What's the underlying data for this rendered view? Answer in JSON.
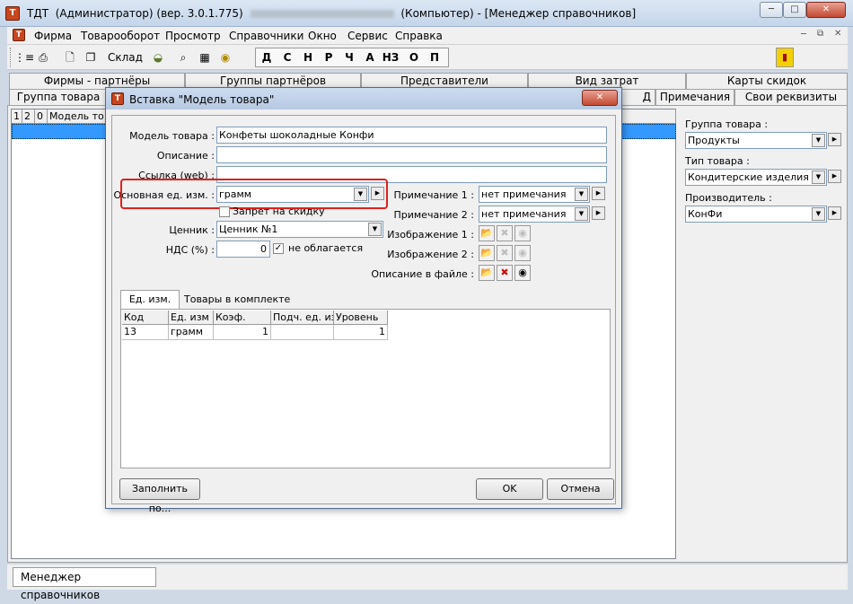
{
  "window": {
    "title_app": "ТДТ",
    "title_user": "(Администратор)",
    "title_version": "(вер. 3.0.1.775)",
    "title_computer": "(Компьютер)",
    "title_module": "- [Менеджер справочников]",
    "min": "─",
    "max": "□",
    "close": "✕",
    "app_icon": "Т"
  },
  "menu": [
    "Фирма",
    "Товарооборот",
    "Просмотр",
    "Справочники",
    "Окно",
    "Сервис",
    "Справка"
  ],
  "mdi_buttons": [
    "─",
    "⧉",
    "✕"
  ],
  "toolbar": {
    "sklad": "Склад",
    "letters": [
      "Д",
      "С",
      "Н",
      "Р",
      "Ч",
      "А",
      "НЗ",
      "О",
      "П"
    ]
  },
  "tabs_row1": [
    "Фирмы - партнёры",
    "Группы партнёров",
    "Представители",
    "Вид затрат",
    "Карты скидок"
  ],
  "tabs_row2": [
    "Группа товара",
    "Д",
    "Примечания",
    "Свои реквизиты"
  ],
  "left_grid": {
    "headers": [
      "1",
      "2",
      "0",
      "Модель то"
    ]
  },
  "right_panel": {
    "group_label": "Группа товара :",
    "group_value": "Продукты",
    "type_label": "Тип товара :",
    "type_value": "Кондитерские изделия",
    "maker_label": "Производитель :",
    "maker_value": "КонФи"
  },
  "dialog": {
    "title": "Вставка \"Модель товара\"",
    "close": "✕",
    "model_label": "Модель товара :",
    "model_value": "Конфеты шоколадные Конфи",
    "desc_label": "Описание :",
    "desc_value": "",
    "link_label": "Ссылка (web) :",
    "link_value": "",
    "unit_label": "Основная ед. изм. :",
    "unit_value": "грамм",
    "no_discount": "Запрет на скидку",
    "pricer_label": "Ценник :",
    "pricer_value": "Ценник №1",
    "vat_label": "НДС (%) :",
    "vat_value": "0",
    "vat_exempt": "не облагается",
    "note1_label": "Примечание 1 :",
    "note1_value": "нет примечания",
    "note2_label": "Примечание 2 :",
    "note2_value": "нет примечания",
    "img1_label": "Изображение 1 :",
    "img2_label": "Изображение 2 :",
    "file_desc_label": "Описание в файле :",
    "tab_units": "Ед. изм.",
    "tab_kit": "Товары в комплекте",
    "grid_headers": [
      "Код",
      "Ед. изм",
      "Коэф.",
      "Подч. ед. изм",
      "Уровень"
    ],
    "grid_rows": [
      [
        "13",
        "грамм",
        "1",
        "",
        "1"
      ]
    ],
    "fill_btn": "Заполнить по...",
    "ok_btn": "OK",
    "cancel_btn": "Отмена"
  },
  "statusbar": {
    "tab": "Менеджер справочников"
  },
  "colors": {
    "highlight_red": "#e0201c",
    "selection_blue": "#3399ff"
  }
}
